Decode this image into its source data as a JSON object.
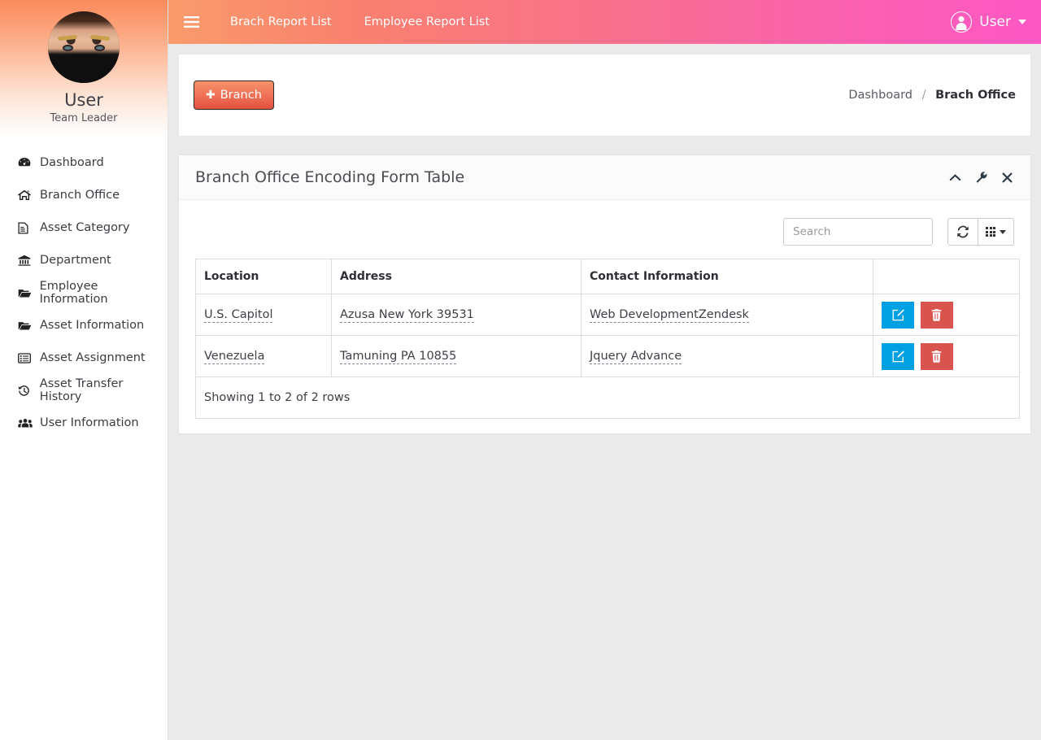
{
  "sidebar": {
    "profile": {
      "name": "User",
      "role": "Team Leader",
      "avatar_icon": "user-avatar-photo"
    },
    "items": [
      {
        "label": "Dashboard",
        "icon": "dashboard-icon"
      },
      {
        "label": "Branch Office",
        "icon": "home-icon"
      },
      {
        "label": "Asset Category",
        "icon": "file-text-icon"
      },
      {
        "label": "Department",
        "icon": "bank-icon"
      },
      {
        "label": "Employee Information",
        "icon": "folder-open-icon"
      },
      {
        "label": "Asset Information",
        "icon": "folder-open-icon"
      },
      {
        "label": "Asset Assignment",
        "icon": "list-alt-icon"
      },
      {
        "label": "Asset Transfer History",
        "icon": "history-icon"
      },
      {
        "label": "User Information",
        "icon": "users-icon"
      }
    ]
  },
  "topbar": {
    "menu_icon": "hamburger-icon",
    "links": [
      {
        "label": "Brach Report List"
      },
      {
        "label": "Employee Report List"
      }
    ],
    "user": {
      "label": "User",
      "icon": "user-circle-icon",
      "caret": "chevron-down-icon"
    }
  },
  "crumb_bar": {
    "add_button": {
      "label": "Branch",
      "icon": "plus-icon"
    },
    "breadcrumb": {
      "root": "Dashboard",
      "separator": "/",
      "current": "Brach Office"
    }
  },
  "panel": {
    "title": "Branch Office Encoding Form Table",
    "tools": [
      {
        "name": "collapse-icon",
        "glyph": "∧"
      },
      {
        "name": "wrench-icon",
        "glyph": "🔧"
      },
      {
        "name": "close-icon",
        "glyph": "✖"
      }
    ]
  },
  "toolbar": {
    "search_placeholder": "Search",
    "search_value": "",
    "refresh_icon": "refresh-icon",
    "columns_icon": "grid-columns-icon"
  },
  "table": {
    "columns": [
      "Location",
      "Address",
      "Contact Information",
      ""
    ],
    "rows": [
      {
        "location": "U.S. Capitol",
        "address": "Azusa New York 39531",
        "contact": "Web DevelopmentZendesk",
        "edit_icon": "edit-icon",
        "delete_icon": "trash-icon"
      },
      {
        "location": "Venezuela",
        "address": "Tamuning PA 10855",
        "contact": "Jquery Advance",
        "edit_icon": "edit-icon",
        "delete_icon": "trash-icon"
      }
    ],
    "footer_text": "Showing 1 to 2 of 2 rows"
  },
  "colors": {
    "header_gradient_start": "#f99b6b",
    "header_gradient_end": "#fc57c4",
    "add_button": "#ef6f55",
    "edit_button": "#00a0e3",
    "delete_button": "#d9534f",
    "content_bg": "#eaeaea"
  }
}
